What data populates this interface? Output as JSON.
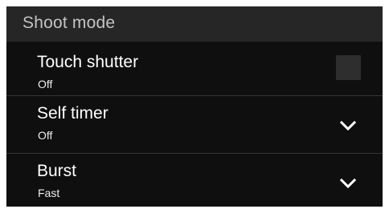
{
  "section": {
    "title": "Shoot mode"
  },
  "settings": [
    {
      "label": "Touch shutter",
      "value": "Off",
      "control": "checkbox",
      "checked": false
    },
    {
      "label": "Self timer",
      "value": "Off",
      "control": "dropdown",
      "icon": "chevron-down-icon"
    },
    {
      "label": "Burst",
      "value": "Fast",
      "control": "dropdown",
      "icon": "chevron-down-icon"
    }
  ],
  "colors": {
    "background": "#0f0f0f",
    "header": "#262626",
    "text_primary": "#ffffff",
    "text_secondary": "#ededed",
    "header_text": "#c4c4c4"
  }
}
